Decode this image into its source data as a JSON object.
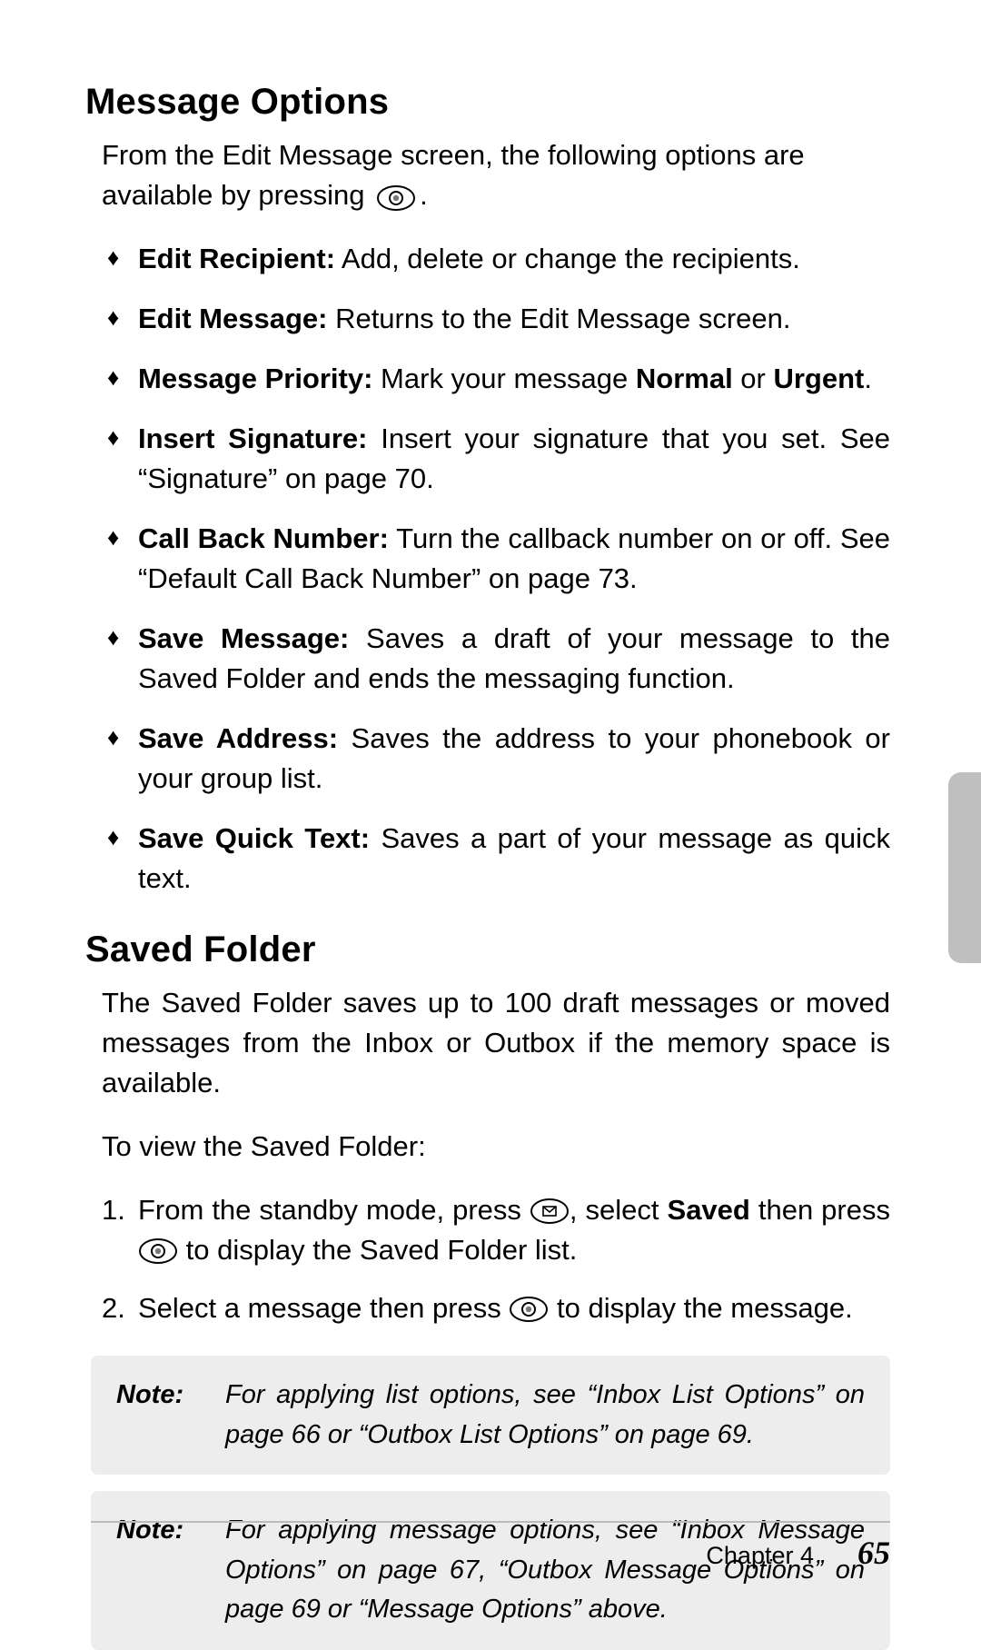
{
  "section1": {
    "title": "Message Options",
    "intro_before": "From the Edit Message screen, the following options are available by pressing ",
    "intro_after": ".",
    "items": [
      {
        "label": "Edit Recipient:",
        "desc_before": " Add, delete or change the recipients."
      },
      {
        "label": "Edit Message:",
        "desc_before": " Returns to the Edit Message screen."
      },
      {
        "label": "Message Priority:",
        "desc_before": " Mark your message ",
        "bold1": "Normal",
        "mid": " or ",
        "bold2": "Urgent",
        "desc_after": "."
      },
      {
        "label": "Insert Signature:",
        "desc_before": " Insert your signature that you set. See “Signature” on page 70."
      },
      {
        "label": "Call Back Number:",
        "desc_before": " Turn the callback number on or off. See “Default Call Back Number” on page 73."
      },
      {
        "label": "Save Message:",
        "desc_before": " Saves a draft of your message to the Saved Folder and ends the messaging function."
      },
      {
        "label": "Save Address:",
        "desc_before": " Saves the address to your phonebook or your group list."
      },
      {
        "label": "Save Quick Text:",
        "desc_before": " Saves a part of your message as quick text."
      }
    ]
  },
  "section2": {
    "title": "Saved Folder",
    "para1": "The Saved Folder saves up to 100 draft messages or moved messages from the Inbox or Outbox if the memory space is available.",
    "para2": "To view the Saved Folder:",
    "steps": {
      "s1_a": "From the standby mode, press ",
      "s1_b": ", select ",
      "s1_bold": "Saved",
      "s1_c": " then press ",
      "s1_d": " to display the Saved Folder list.",
      "s2_a": "Select a message then press ",
      "s2_b": " to display the message."
    }
  },
  "notes": {
    "label": "Note:",
    "n1": "For applying list options, see “Inbox List Options” on page 66 or “Outbox List Options” on page 69.",
    "n2": "For applying message options, see “Inbox Message Options” on page 67, “Outbox Message Options” on page 69 or “Message Options” above."
  },
  "footer": {
    "chapter": "Chapter 4",
    "page": "65"
  }
}
